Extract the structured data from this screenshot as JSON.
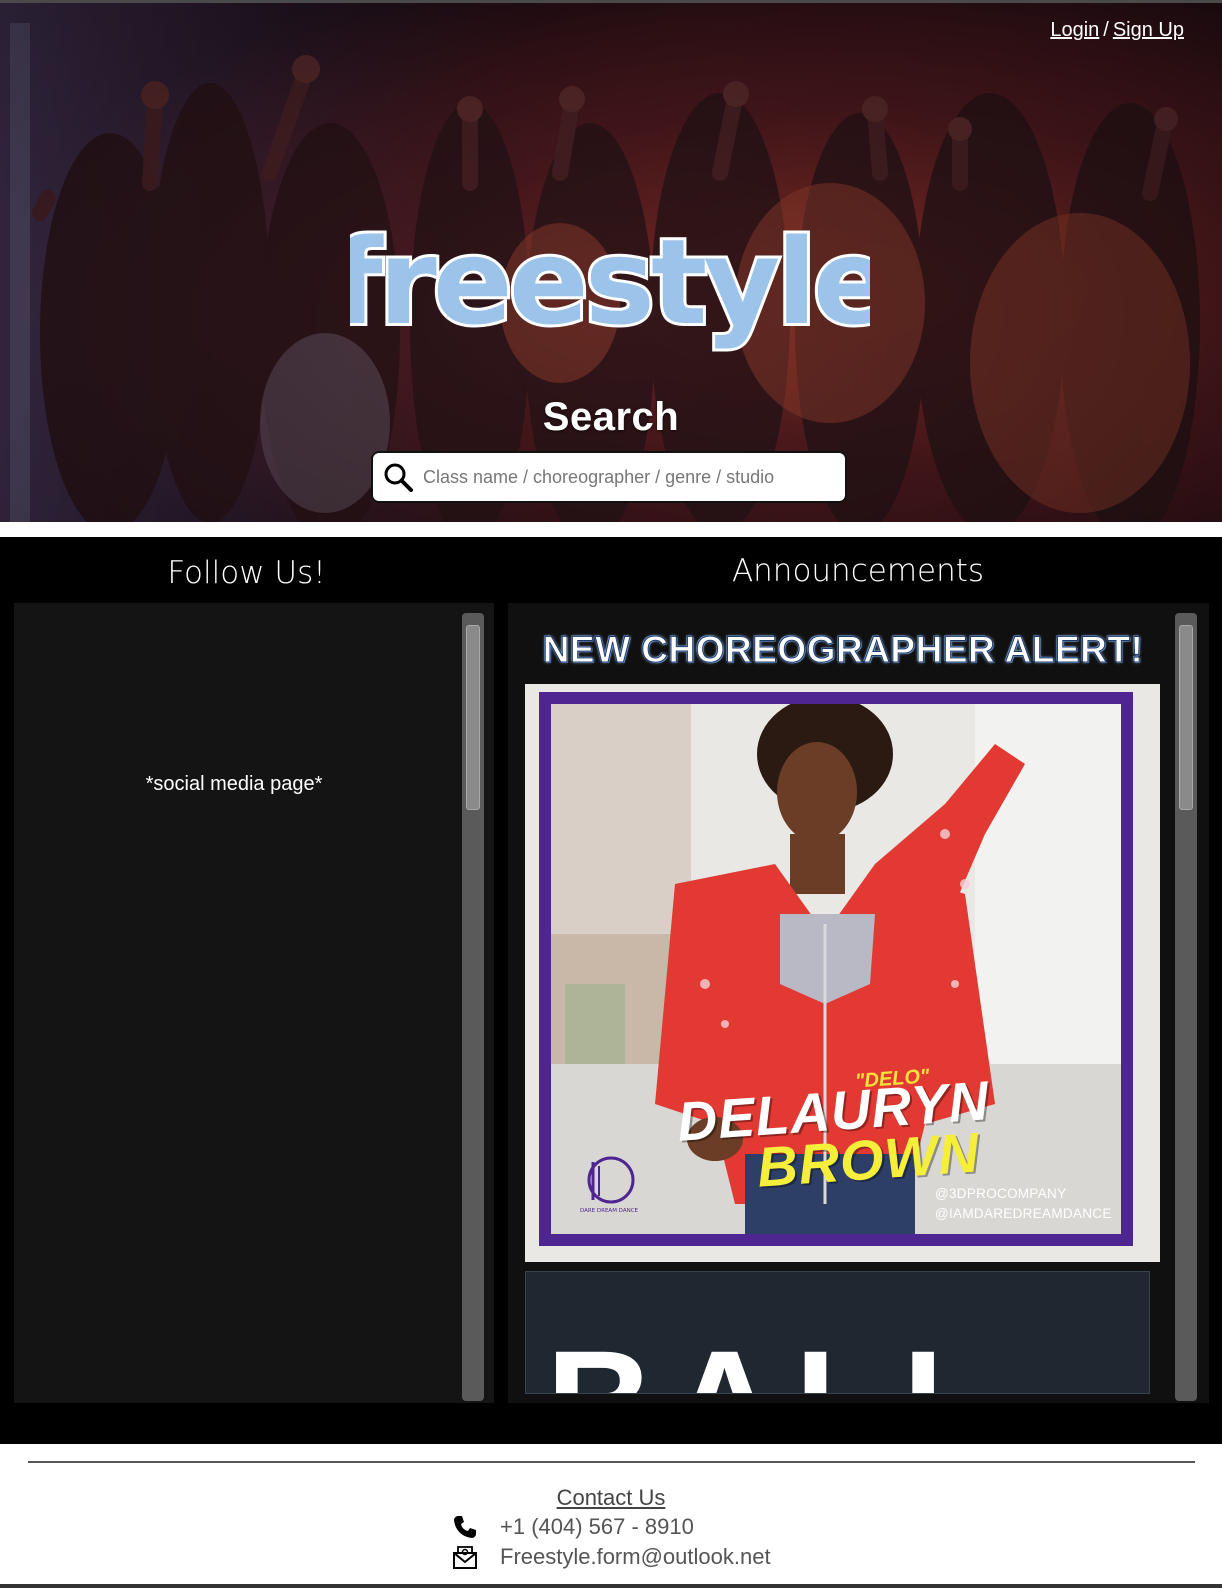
{
  "header": {
    "login_label": "Login",
    "separator": "/",
    "signup_label": "Sign Up",
    "logo_text": "freestyle",
    "logo_color": "#9cc3ea"
  },
  "search": {
    "heading": "Search",
    "placeholder": "Class name / choreographer / genre / studio"
  },
  "follow": {
    "title": "Follow Us!",
    "placeholder_text": "*social media page*"
  },
  "announcements": {
    "title": "Announcements",
    "alert_heading": "NEW CHOREOGRAPHER ALERT!",
    "poster": {
      "nickname": "\"DELO\"",
      "first_name": "DELAURYN",
      "last_name": "BROWN",
      "handle_1": "@3DPROCOMPANY",
      "handle_2": "@IAMDAREDREAMDANCE",
      "logo_caption": "DARE DREAM DANCE",
      "frame_color": "#4f2591"
    },
    "next_card_text": "BALL"
  },
  "footer": {
    "contact_title": "Contact Us",
    "phone": "+1 (404) 567 - 8910",
    "email": "Freestyle.form@outlook.net"
  }
}
